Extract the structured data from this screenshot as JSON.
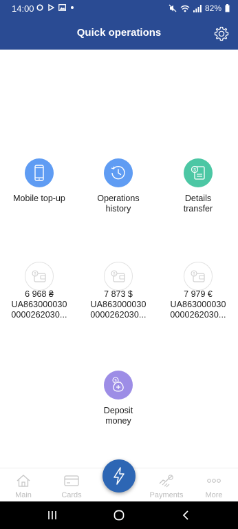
{
  "status_bar": {
    "time": "14:00",
    "battery": "82%",
    "left_icons": [
      "circle-icon",
      "play-icon",
      "image-icon",
      "dot-icon"
    ],
    "right_icons": [
      "mute-icon",
      "wifi-icon",
      "signal-icon",
      "battery-icon"
    ]
  },
  "header": {
    "title": "Quick operations",
    "settings_icon": "gear-icon",
    "bg_color": "#2a4b93"
  },
  "operations": [
    {
      "label_lines": [
        "Mobile top-up"
      ],
      "icon": "phone-icon",
      "color": "#5f9cf3"
    },
    {
      "label_lines": [
        "Operations",
        "history"
      ],
      "icon": "history-icon",
      "color": "#5f9cf3"
    },
    {
      "label_lines": [
        "Details",
        "transfer"
      ],
      "icon": "document-icon",
      "color": "#4cc7a4"
    }
  ],
  "accounts": [
    {
      "amount": "6 968 ₴",
      "iban_line1": "UA863000030",
      "iban_line2": "0000262030..."
    },
    {
      "amount": "7 873 $",
      "iban_line1": "UA863000030",
      "iban_line2": "0000262030..."
    },
    {
      "amount": "7 979 €",
      "iban_line1": "UA863000030",
      "iban_line2": "0000262030..."
    }
  ],
  "deposit": {
    "label_lines": [
      "Deposit",
      "money"
    ],
    "icon": "money-bag-icon",
    "color": "#9d8de6"
  },
  "bottom_nav": {
    "items": [
      {
        "label": "Main",
        "icon": "home-icon"
      },
      {
        "label": "Cards",
        "icon": "card-icon"
      },
      {
        "label": "Payments",
        "icon": "handshake-icon"
      },
      {
        "label": "More",
        "icon": "more-icon"
      }
    ],
    "center_icon": "lightning-icon",
    "center_color": "#2d66b4"
  },
  "system_nav": [
    "recents-icon",
    "home-circle-icon",
    "back-icon"
  ]
}
